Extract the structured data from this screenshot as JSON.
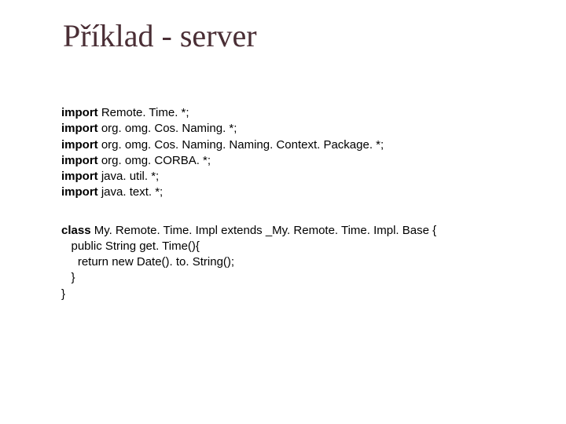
{
  "title": "Příklad - server",
  "imports": [
    {
      "kw": "import",
      "rest": " Remote. Time. *;"
    },
    {
      "kw": "import",
      "rest": " org. omg. Cos. Naming. *;"
    },
    {
      "kw": "import",
      "rest": " org. omg. Cos. Naming. Naming. Context. Package. *;"
    },
    {
      "kw": "import",
      "rest": " org. omg. CORBA. *;"
    },
    {
      "kw": "import",
      "rest": " java. util. *;"
    },
    {
      "kw": "import",
      "rest": " java. text. *;"
    }
  ],
  "class_lines": [
    {
      "kw": "class",
      "rest": " My. Remote. Time. Impl extends _My. Remote. Time. Impl. Base {"
    },
    {
      "kw": "",
      "rest": "   public String get. Time(){"
    },
    {
      "kw": "",
      "rest": "     return new Date(). to. String();"
    },
    {
      "kw": "",
      "rest": "   }"
    },
    {
      "kw": "",
      "rest": "}"
    }
  ]
}
